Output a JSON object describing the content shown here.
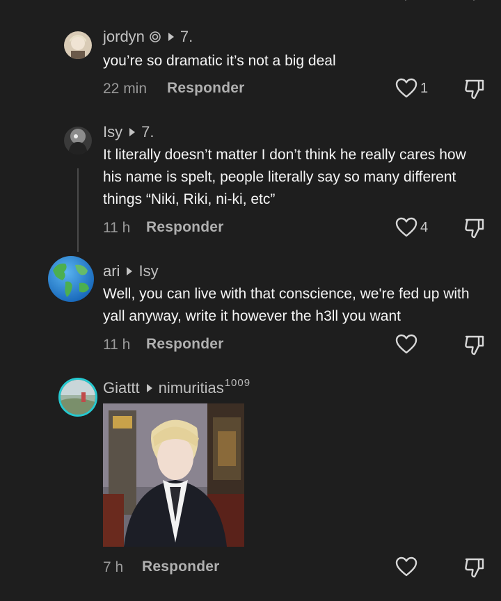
{
  "comments": [
    {
      "username": "jordyn",
      "reply_to": "7.",
      "text": "you’re so dramatic it’s not a big deal",
      "time": "22 min",
      "reply_label": "Responder",
      "likes": "1"
    },
    {
      "username": "Isy",
      "reply_to": "7.",
      "text": "It literally doesn’t matter I don’t think he really cares how his name is spelt, people literally say so many different things “Niki, Riki, ni-ki, etc”",
      "time": "11 h",
      "reply_label": "Responder",
      "likes": "4"
    },
    {
      "username": "ari",
      "reply_to": "Isy",
      "text": "Well, you can live with that conscience, we're fed up with yall anyway, write it however the h3ll you want",
      "time": "11 h",
      "reply_label": "Responder",
      "likes": ""
    },
    {
      "username": "Giattt",
      "reply_to": "nimuritias",
      "reply_to_suffix": "1009",
      "text": "",
      "time": "7 h",
      "reply_label": "Responder",
      "likes": ""
    }
  ],
  "icons": {
    "badge": "spiral-badge-icon",
    "like": "heart-outline-icon",
    "dislike": "thumbs-down-outline-icon",
    "reply_arrow": "triangle-right-icon"
  },
  "colors": {
    "background": "#1e1e1e",
    "text": "#f5f5f5",
    "muted": "#9a9a9a"
  }
}
